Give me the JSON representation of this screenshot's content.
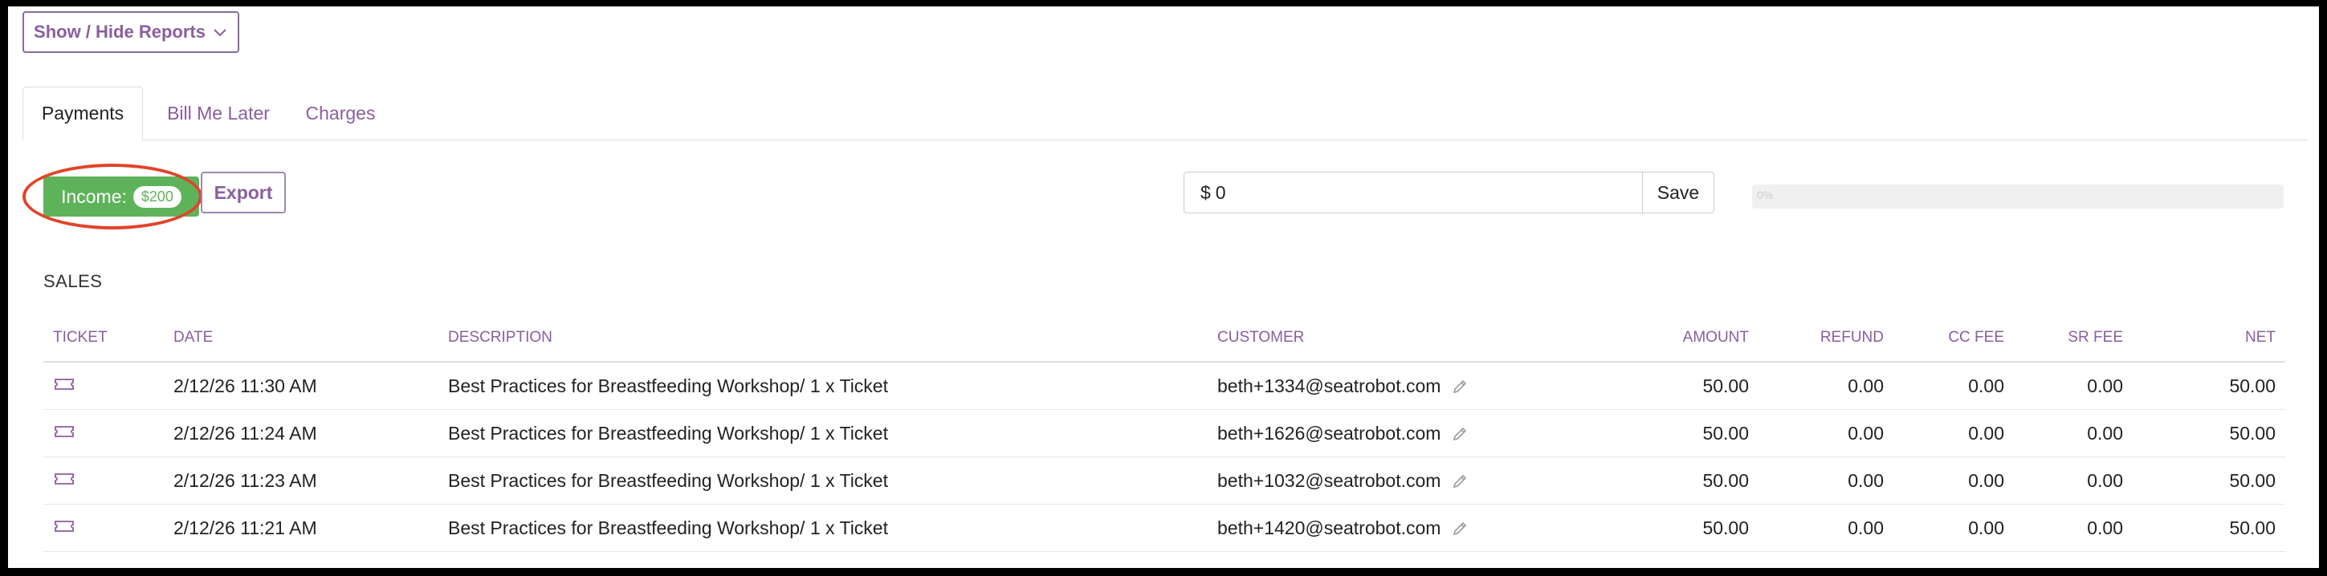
{
  "toolbar": {
    "show_hide_label": "Show / Hide Reports"
  },
  "tabs": [
    {
      "label": "Payments",
      "active": true
    },
    {
      "label": "Bill Me Later",
      "active": false
    },
    {
      "label": "Charges",
      "active": false
    }
  ],
  "income": {
    "label": "Income:",
    "value": "$200",
    "export_label": "Export"
  },
  "amount": {
    "prefix": "$",
    "value": "0",
    "save_label": "Save"
  },
  "progress": {
    "label": "0%",
    "fraction": 0
  },
  "sales": {
    "title": "SALES",
    "columns": [
      "TICKET",
      "DATE",
      "DESCRIPTION",
      "CUSTOMER",
      "AMOUNT",
      "REFUND",
      "CC FEE",
      "SR FEE",
      "NET"
    ],
    "rows": [
      {
        "date": "2/12/26 11:30 AM",
        "description": "Best Practices for Breastfeeding Workshop/ 1 x Ticket",
        "customer": "beth+1334@seatrobot.com",
        "amount": "50.00",
        "refund": "0.00",
        "cc_fee": "0.00",
        "sr_fee": "0.00",
        "net": "50.00"
      },
      {
        "date": "2/12/26 11:24 AM",
        "description": "Best Practices for Breastfeeding Workshop/ 1 x Ticket",
        "customer": "beth+1626@seatrobot.com",
        "amount": "50.00",
        "refund": "0.00",
        "cc_fee": "0.00",
        "sr_fee": "0.00",
        "net": "50.00"
      },
      {
        "date": "2/12/26 11:23 AM",
        "description": "Best Practices for Breastfeeding Workshop/ 1 x Ticket",
        "customer": "beth+1032@seatrobot.com",
        "amount": "50.00",
        "refund": "0.00",
        "cc_fee": "0.00",
        "sr_fee": "0.00",
        "net": "50.00"
      },
      {
        "date": "2/12/26 11:21 AM",
        "description": "Best Practices for Breastfeeding Workshop/ 1 x Ticket",
        "customer": "beth+1420@seatrobot.com",
        "amount": "50.00",
        "refund": "0.00",
        "cc_fee": "0.00",
        "sr_fee": "0.00",
        "net": "50.00"
      }
    ]
  },
  "icons": {
    "ticket": "ticket-icon",
    "edit": "pencil-icon",
    "dropdown": "chevron-down-icon"
  },
  "colors": {
    "accent": "#8a5e9e",
    "income_green": "#5eb35a",
    "highlight_ring": "#e0442a"
  }
}
